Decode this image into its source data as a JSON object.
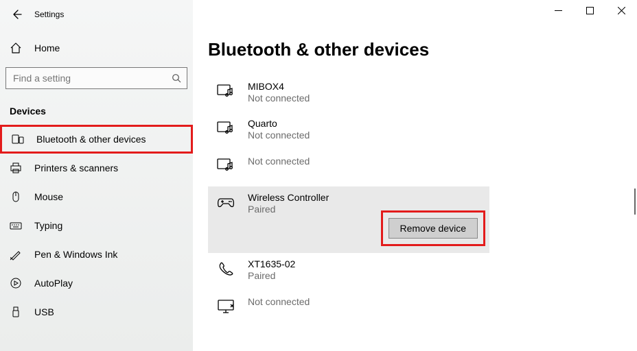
{
  "app_title": "Settings",
  "home_label": "Home",
  "search_placeholder": "Find a setting",
  "section_header": "Devices",
  "nav": [
    {
      "id": "bluetooth",
      "label": "Bluetooth & other devices",
      "highlight": true
    },
    {
      "id": "printers",
      "label": "Printers & scanners"
    },
    {
      "id": "mouse",
      "label": "Mouse"
    },
    {
      "id": "typing",
      "label": "Typing"
    },
    {
      "id": "pen",
      "label": "Pen & Windows Ink"
    },
    {
      "id": "autoplay",
      "label": "AutoPlay"
    },
    {
      "id": "usb",
      "label": "USB"
    }
  ],
  "page_heading": "Bluetooth & other devices",
  "devices": [
    {
      "name": "MIBOX4",
      "status": "Not connected",
      "icon": "media"
    },
    {
      "name": "Quarto",
      "status": "Not connected",
      "icon": "media"
    },
    {
      "name": "",
      "status": "Not connected",
      "icon": "media"
    },
    {
      "name": "Wireless Controller",
      "status": "Paired",
      "icon": "gamepad",
      "selected": true
    },
    {
      "name": "XT1635-02",
      "status": "Paired",
      "icon": "phone"
    },
    {
      "name": "",
      "status": "Not connected",
      "icon": "display"
    }
  ],
  "remove_button_label": "Remove device"
}
